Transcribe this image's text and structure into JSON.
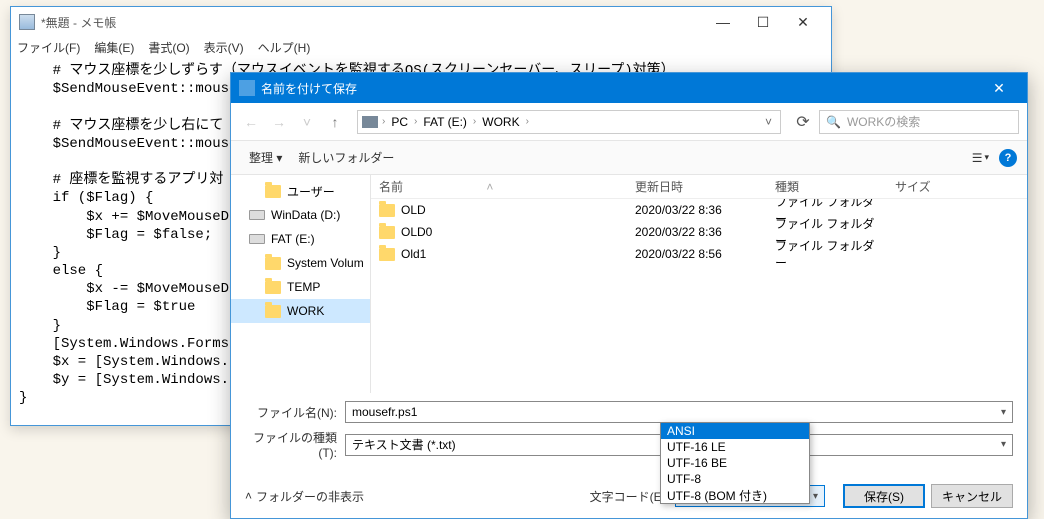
{
  "notepad": {
    "title": "*無題 - メモ帳",
    "menu": [
      "ファイル(F)",
      "編集(E)",
      "書式(O)",
      "表示(V)",
      "ヘルプ(H)"
    ],
    "content": "    # マウス座標を少しずらす（マウスイベントを監視するOS(スクリーンセーバー、スリープ)対策）\n    $SendMouseEvent::mouse_\n\n    # マウス座標を少し右にて\n    $SendMouseEvent::mouse_\n\n    # 座標を監視するアプリ対\n    if ($Flag) {\n        $x += $MoveMouseDis\n        $Flag = $false;\n    }\n    else {\n        $x -= $MoveMouseDis\n        $Flag = $true\n    }\n    [System.Windows.Forms.C\n    $x = [System.Windows.Fo\n    $y = [System.Windows.Fo\n}"
  },
  "dialog": {
    "title": "名前を付けて保存",
    "breadcrumb": [
      "PC",
      "FAT (E:)",
      "WORK"
    ],
    "search_placeholder": "WORKの検索",
    "toolbar": {
      "organize": "整理",
      "newfolder": "新しいフォルダー"
    },
    "tree": [
      {
        "label": "ユーザー",
        "icon": "folder",
        "indent": true
      },
      {
        "label": "WinData (D:)",
        "icon": "drive"
      },
      {
        "label": "FAT (E:)",
        "icon": "drive"
      },
      {
        "label": "System Volum",
        "icon": "folder",
        "indent": true
      },
      {
        "label": "TEMP",
        "icon": "folder",
        "indent": true
      },
      {
        "label": "WORK",
        "icon": "folder",
        "indent": true,
        "selected": true
      }
    ],
    "columns": {
      "name": "名前",
      "date": "更新日時",
      "type": "種類",
      "size": "サイズ"
    },
    "files": [
      {
        "name": "OLD",
        "date": "2020/03/22 8:36",
        "type": "ファイル フォルダー"
      },
      {
        "name": "OLD0",
        "date": "2020/03/22 8:36",
        "type": "ファイル フォルダー"
      },
      {
        "name": "Old1",
        "date": "2020/03/22 8:56",
        "type": "ファイル フォルダー"
      }
    ],
    "filename_label": "ファイル名(N):",
    "filename_value": "mousefr.ps1",
    "filetype_label": "ファイルの種類(T):",
    "filetype_value": "テキスト文書 (*.txt)",
    "hide_folders": "フォルダーの非表示",
    "encoding_label": "文字コード(E):",
    "encoding_value": "ANSI",
    "encoding_options": [
      "ANSI",
      "UTF-16 LE",
      "UTF-16 BE",
      "UTF-8",
      "UTF-8 (BOM 付き)"
    ],
    "save_button": "保存(S)",
    "cancel_button": "キャンセル"
  }
}
